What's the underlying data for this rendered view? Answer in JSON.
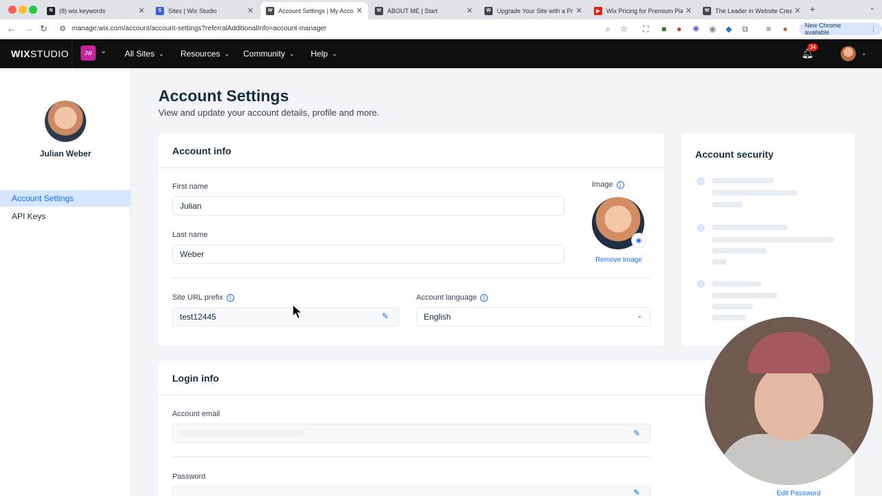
{
  "browser": {
    "tabs": [
      {
        "title": "(8) wix keywords",
        "icon": "notion-icon",
        "color": "#222222"
      },
      {
        "title": "Sites | Wix Studio",
        "icon": "wix-icon",
        "color": "#3a61d6"
      },
      {
        "title": "Account Settings | My Account",
        "icon": "wix-icon",
        "color": "#444444"
      },
      {
        "title": "ABOUT ME | Start",
        "icon": "wix-icon",
        "color": "#444444"
      },
      {
        "title": "Upgrade Your Site with a Premium Plan",
        "icon": "wix-icon",
        "color": "#444444"
      },
      {
        "title": "Wix Pricing for Premium Plans",
        "icon": "youtube-icon",
        "color": "#e62117"
      },
      {
        "title": "The Leader in Website Creation",
        "icon": "wix-icon",
        "color": "#444444"
      }
    ],
    "url": "manage.wix.com/account/account-settings?referralAdditionalInfo=account-manager",
    "new_chrome_label": "New Chrome available"
  },
  "topnav": {
    "logo_bold": "WIX",
    "logo_rest": "STUDIO",
    "workspace_initials": "JW",
    "menus": [
      "All Sites",
      "Resources",
      "Community",
      "Help"
    ],
    "notification_count": "34"
  },
  "sidebar": {
    "user_name": "Julian Weber",
    "items": [
      "Account Settings",
      "API Keys"
    ]
  },
  "page": {
    "title": "Account Settings",
    "subtitle": "View and update your account details, profile and more."
  },
  "account_info": {
    "heading": "Account info",
    "first_name_label": "First name",
    "first_name": "Julian",
    "last_name_label": "Last name",
    "last_name": "Weber",
    "image_label": "Image",
    "remove_image": "Remove Image",
    "site_url_label": "Site URL prefix",
    "site_url": "test12445",
    "language_label": "Account language",
    "language": "English"
  },
  "account_security": {
    "heading": "Account security"
  },
  "login_info": {
    "heading": "Login info",
    "email_label": "Account email",
    "password_label": "Password",
    "edit_password": "Edit Password"
  },
  "colors": {
    "accent": "#116dff",
    "nav_bg": "#0f0f10",
    "badge": "#c2249a",
    "notification": "#e62214"
  }
}
